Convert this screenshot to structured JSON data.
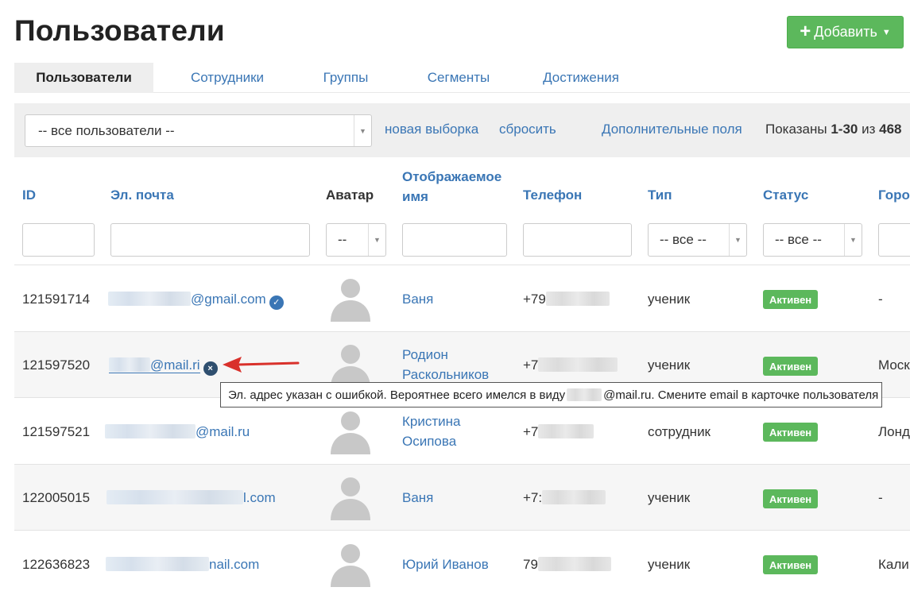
{
  "header": {
    "title": "Пользователи",
    "add_button": "Добавить"
  },
  "tabs": [
    "Пользователи",
    "Сотрудники",
    "Группы",
    "Сегменты",
    "Достижения"
  ],
  "filter_bar": {
    "selection_value": "-- все пользователи --",
    "new_selection": "новая выборка",
    "reset": "сбросить",
    "extra_fields": "Дополнительные поля",
    "shown_prefix": "Показаны",
    "shown_range": "1-30",
    "shown_of": "из",
    "shown_total": "468"
  },
  "columns": {
    "id": "ID",
    "email": "Эл. почта",
    "avatar": "Аватар",
    "display_name_1": "Отображаемое",
    "display_name_2": "имя",
    "phone": "Телефон",
    "type": "Тип",
    "status": "Статус",
    "city": "Горо"
  },
  "column_filters": {
    "avatar": "--",
    "type": "-- все --",
    "status": "-- все --"
  },
  "rows": [
    {
      "id": "121591714",
      "email_visible": "@gmail.com",
      "name_1": "Ваня",
      "name_2": "",
      "phone_visible": "+79",
      "type": "ученик",
      "status": "Активен",
      "city": "-"
    },
    {
      "id": "121597520",
      "email_visible": "@mail.ri",
      "name_1": "Родион",
      "name_2": "Раскольников",
      "phone_visible": "+7",
      "type": "ученик",
      "status": "Активен",
      "city": "Моск"
    },
    {
      "id": "121597521",
      "email_visible": "@mail.ru",
      "name_1": "Кристина",
      "name_2": "Осипова",
      "phone_visible": "+7",
      "type": "сотрудник",
      "status": "Активен",
      "city": "Лонд"
    },
    {
      "id": "122005015",
      "email_visible": "l.com",
      "name_1": "Ваня",
      "name_2": "",
      "phone_visible": "+7:",
      "type": "ученик",
      "status": "Активен",
      "city": "-"
    },
    {
      "id": "122636823",
      "email_visible": "nail.com",
      "name_1": "Юрий Иванов",
      "name_2": "",
      "phone_visible": "79",
      "type": "ученик",
      "status": "Активен",
      "city": "Кали"
    }
  ],
  "tooltip": {
    "before": "Эл. адрес указан с ошибкой. Вероятнее всего имелся в виду",
    "after": "@mail.ru. Смените email в карточке пользователя"
  },
  "icons": {
    "verified": "check-circle-icon",
    "error": "x-circle-icon",
    "avatar": "user-silhouette-icon",
    "add": "plus-icon"
  },
  "colors": {
    "link": "#3a76b5",
    "success": "#5cb85c",
    "filter_bg": "#efefef",
    "arrow": "#d9312b"
  }
}
